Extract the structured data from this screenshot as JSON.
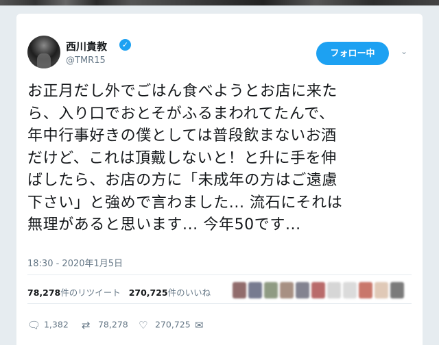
{
  "tweet": {
    "author_name": "西川貴教",
    "author_handle": "@TMR15",
    "verified_icon": "verified-badge-icon",
    "follow_button_label": "フォロー中",
    "text_lines": [
      "お正月だし外でごはん食べようとお店に来た",
      "ら、入り口でおとそがふるまわれてたんで、",
      "年中行事好きの僕としては普段飲まないお酒",
      "だけど、これは頂戴しないと！と升に手を伸",
      "ばしたら、お店の方に「未成年の方はご遠慮",
      "下さい」と強めで言わました... 流石にそれは",
      "無理があると思います... 今年50です..."
    ],
    "timestamp": "18:30 - 2020年1月5日",
    "retweet_count": "78,278",
    "retweet_label": "件のリツイート",
    "like_count": "270,725",
    "like_label": "件のいいね",
    "actions": {
      "reply_count": "1,382",
      "retweet_count": "78,278",
      "like_count": "270,725"
    },
    "liker_colors": [
      "#6d3b3b",
      "#4a4f6b",
      "#6a7a5a",
      "#8a6b5a",
      "#5a5a6b",
      "#a23a3a",
      "#c9c9c9",
      "#d0d0d0",
      "#b84a3a",
      "#d6b8a0",
      "#4f4f4f"
    ]
  },
  "colors": {
    "accent": "#1da1f2",
    "muted_text": "#657786",
    "background": "#e6ecf0"
  }
}
